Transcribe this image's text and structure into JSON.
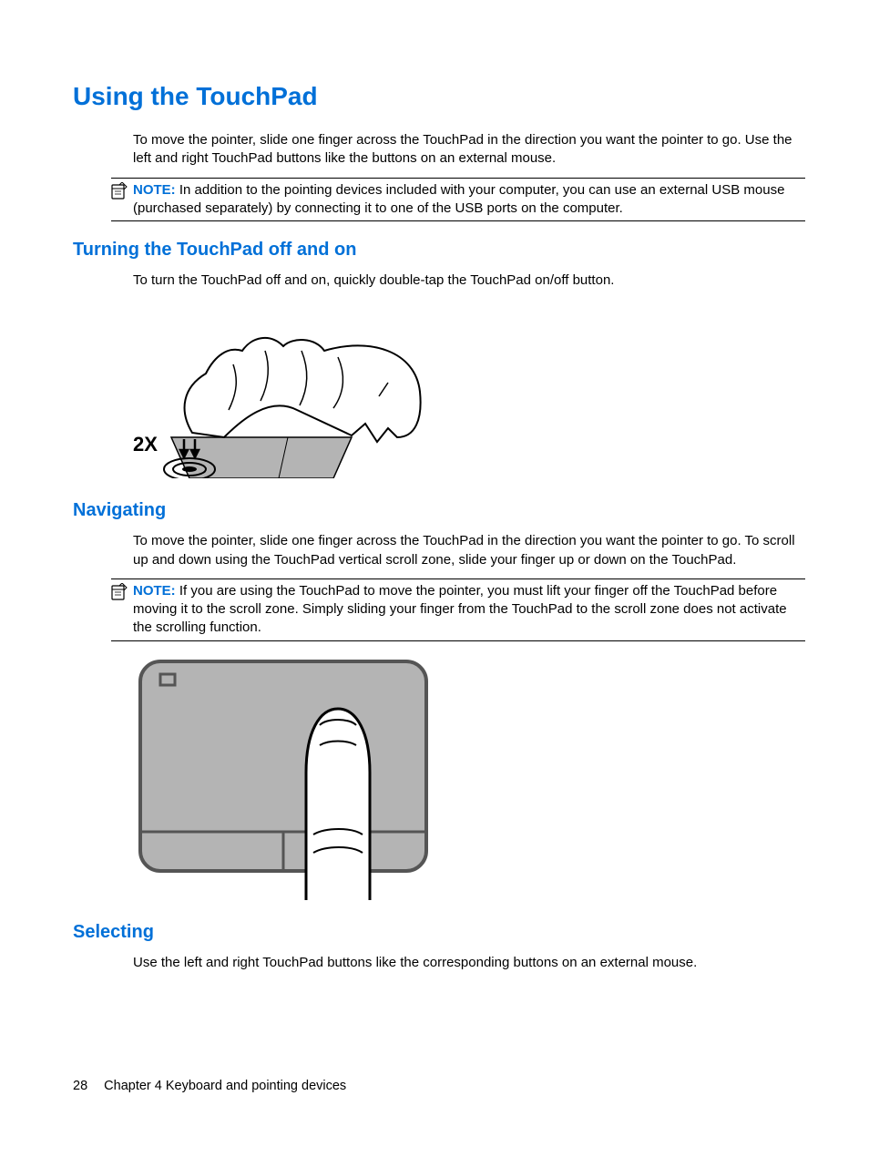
{
  "heading": "Using the TouchPad",
  "intro": "To move the pointer, slide one finger across the TouchPad in the direction you want the pointer to go. Use the left and right TouchPad buttons like the buttons on an external mouse.",
  "note1_label": "NOTE:",
  "note1_text": "In addition to the pointing devices included with your computer, you can use an external USB mouse (purchased separately) by connecting it to one of the USB ports on the computer.",
  "section_turning": {
    "heading": "Turning the TouchPad off and on",
    "text": "To turn the TouchPad off and on, quickly double-tap the TouchPad on/off button.",
    "tap_label": "2X"
  },
  "section_navigating": {
    "heading": "Navigating",
    "text": "To move the pointer, slide one finger across the TouchPad in the direction you want the pointer to go. To scroll up and down using the TouchPad vertical scroll zone, slide your finger up or down on the TouchPad.",
    "note_label": "NOTE:",
    "note_text": "If you are using the TouchPad to move the pointer, you must lift your finger off the TouchPad before moving it to the scroll zone. Simply sliding your finger from the TouchPad to the scroll zone does not activate the scrolling function."
  },
  "section_selecting": {
    "heading": "Selecting",
    "text": "Use the left and right TouchPad buttons like the corresponding buttons on an external mouse."
  },
  "footer": {
    "page": "28",
    "chapter": "Chapter 4   Keyboard and pointing devices"
  }
}
